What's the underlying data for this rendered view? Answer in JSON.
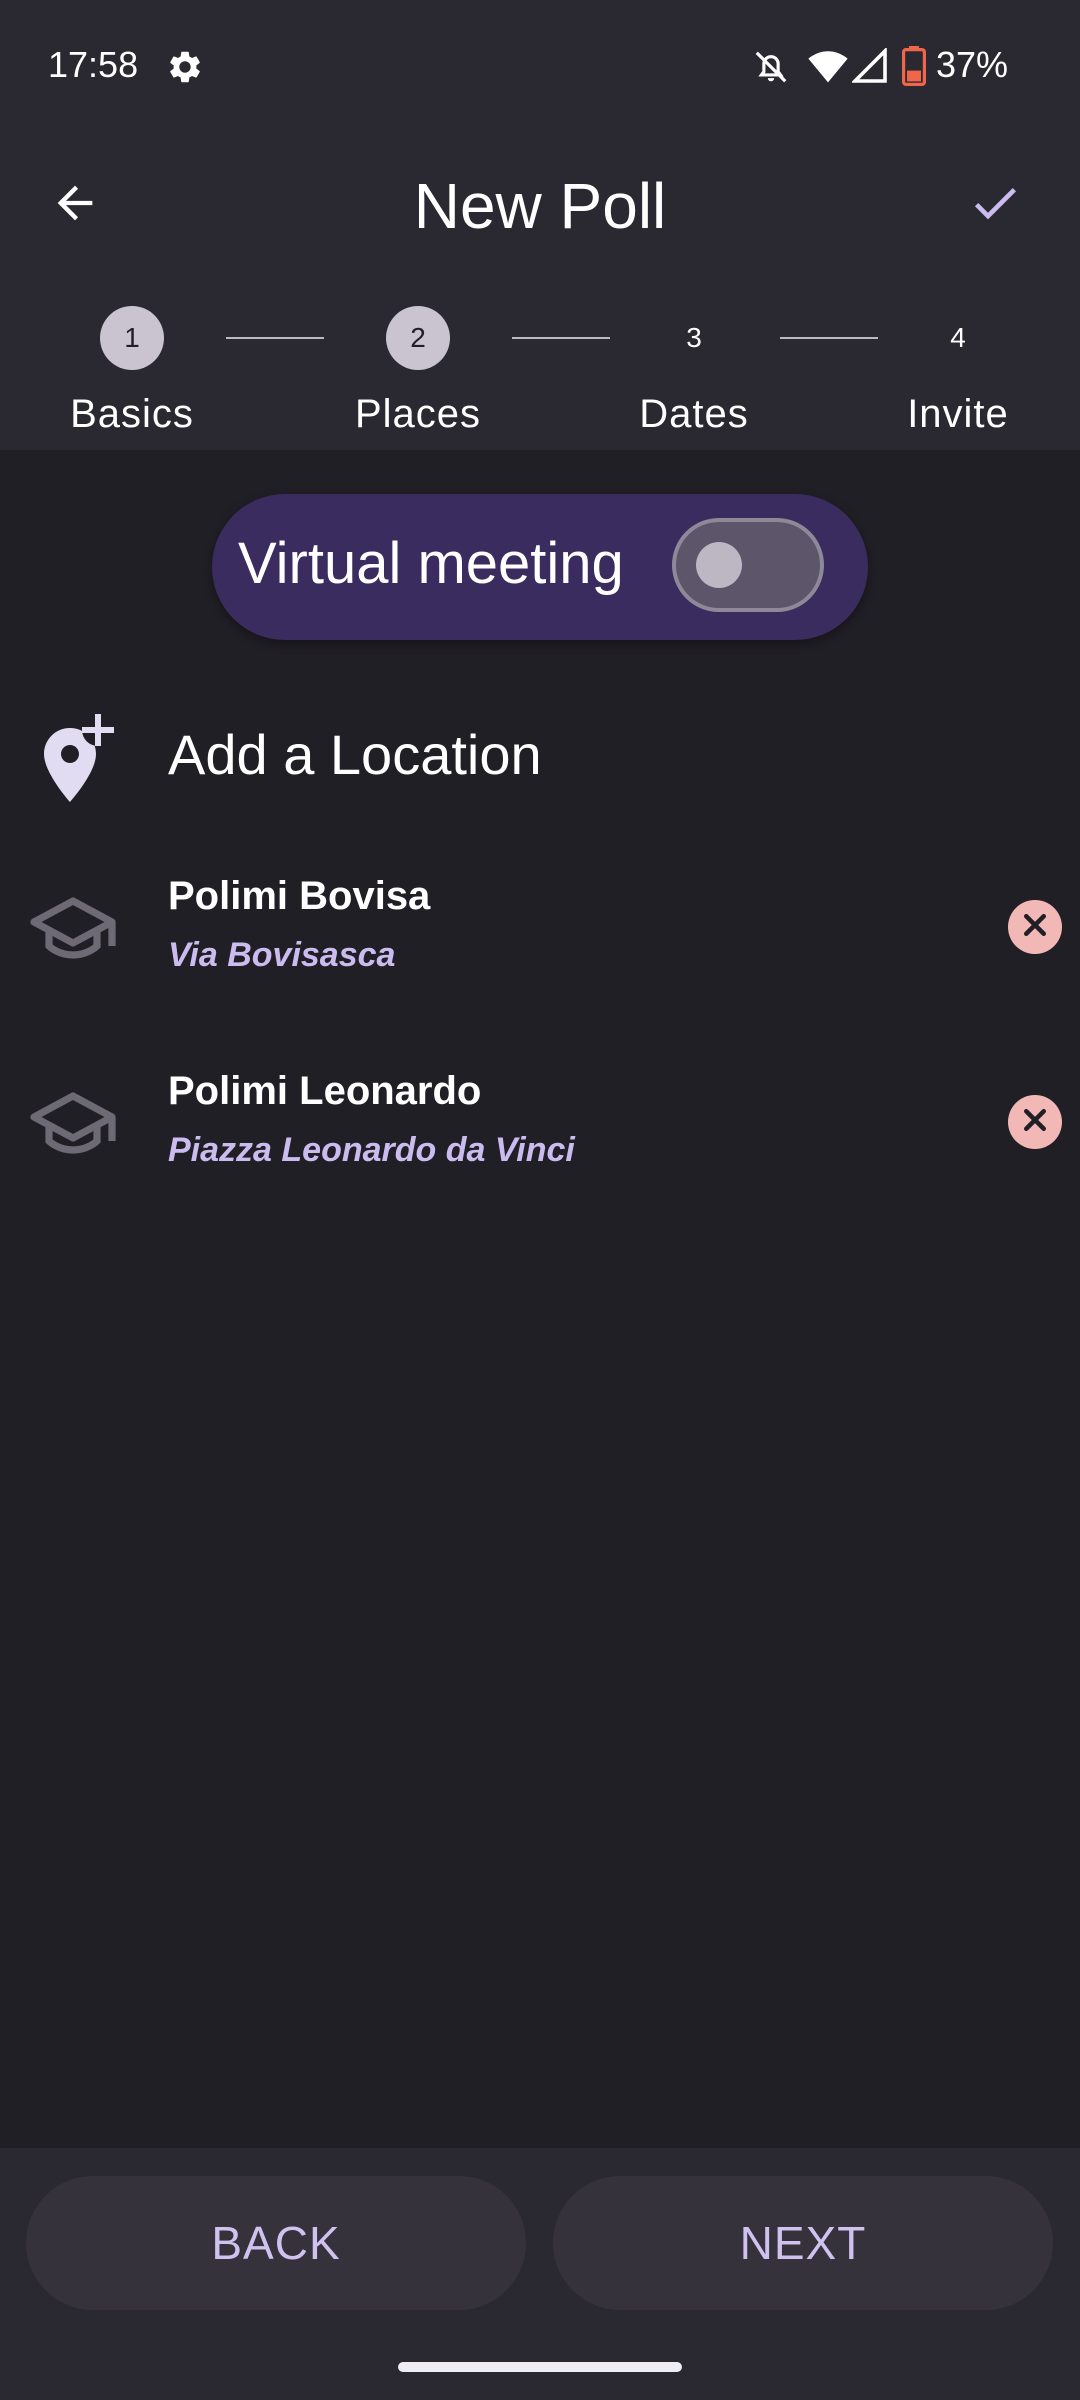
{
  "status_bar": {
    "time": "17:58",
    "battery": "37%",
    "icons": [
      "settings-icon",
      "notifications-off-icon",
      "wifi-icon",
      "signal-icon",
      "battery-icon"
    ]
  },
  "app_bar": {
    "title": "New Poll",
    "back_icon": "arrow-back-icon",
    "confirm_icon": "check-icon"
  },
  "stepper": {
    "steps": [
      {
        "number": "1",
        "label": "Basics"
      },
      {
        "number": "2",
        "label": "Places"
      },
      {
        "number": "3",
        "label": "Dates"
      },
      {
        "number": "4",
        "label": "Invite"
      }
    ]
  },
  "virtual_meeting": {
    "label": "Virtual meeting",
    "enabled": false
  },
  "add_location": {
    "label": "Add a Location",
    "icon": "add-location-icon"
  },
  "locations": [
    {
      "name": "Polimi Bovisa",
      "address": "Via Bovisasca",
      "icon": "school-icon"
    },
    {
      "name": "Polimi Leonardo",
      "address": "Piazza Leonardo da Vinci",
      "icon": "school-icon"
    }
  ],
  "bottom": {
    "back_label": "BACK",
    "next_label": "NEXT"
  },
  "colors": {
    "background": "#211f26",
    "surface": "#2a2830",
    "accent": "#cbbcf0",
    "pill": "#3a2c5e",
    "remove": "#f2b8b5"
  }
}
